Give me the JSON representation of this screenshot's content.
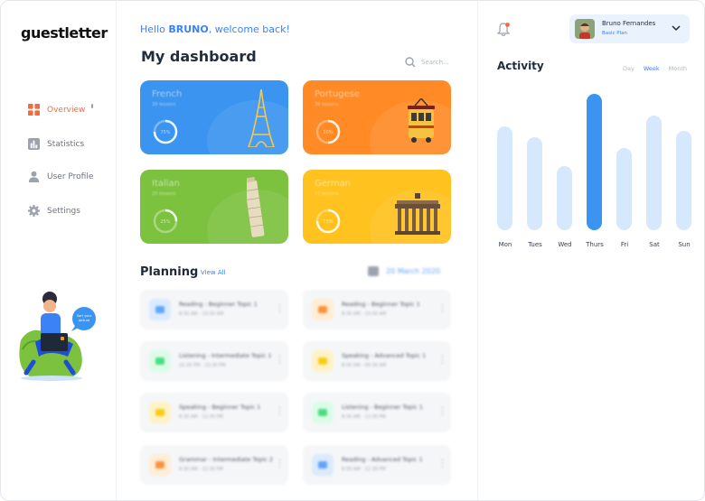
{
  "brand": {
    "logo": "guestletter"
  },
  "sidebar": {
    "items": [
      {
        "label": "Overview",
        "icon": "grid-icon",
        "active": true
      },
      {
        "label": "Statistics",
        "icon": "bar-chart-icon",
        "active": false
      },
      {
        "label": "User Profile",
        "icon": "user-icon",
        "active": false
      },
      {
        "label": "Settings",
        "icon": "gear-icon",
        "active": false
      }
    ],
    "promo_bubble": "Sort your picture"
  },
  "header": {
    "greeting_prefix": "Hello ",
    "user": "BRUNO",
    "greeting_suffix": ", welcome back!",
    "title": "My dashboard",
    "search_placeholder": "Search..."
  },
  "courses": [
    {
      "language": "French",
      "lessons": "39 lessons",
      "progress": "75%",
      "color": "#3b94f0",
      "icon": "eiffel-tower-icon"
    },
    {
      "language": "Portugese",
      "lessons": "39 lessons",
      "progress": "50%",
      "color": "#ff8a26",
      "icon": "tram-icon"
    },
    {
      "language": "Italian",
      "lessons": "20 lessons",
      "progress": "25%",
      "color": "#7cc23f",
      "icon": "leaning-tower-icon"
    },
    {
      "language": "German",
      "lessons": "15 lessons",
      "progress": "75%",
      "color": "#ffc21f",
      "icon": "brandenburg-gate-icon"
    }
  ],
  "planning": {
    "title": "Planning",
    "view_all": "View All",
    "date": "20 March 2020",
    "lessons": [
      {
        "title": "Reading - Beginner Topic 1",
        "time": "8:30 AM - 10:30 AM",
        "icon": "book-icon",
        "tint": "#dbeafe",
        "fg": "#60a5fa"
      },
      {
        "title": "Reading - Beginner Topic 1",
        "time": "8:30 AM - 10:30 AM",
        "icon": "pen-icon",
        "tint": "#ffedd5",
        "fg": "#fb923c"
      },
      {
        "title": "Listening - Intermediate Topic 1",
        "time": "22:30 PM - 23:30 PM",
        "icon": "headphones-icon",
        "tint": "#dcfce7",
        "fg": "#4ade80"
      },
      {
        "title": "Speaking - Advanced Topic 1",
        "time": "8:30 AM - 09:30 AM",
        "icon": "speaker-icon",
        "tint": "#fef3c7",
        "fg": "#facc15"
      },
      {
        "title": "Speaking - Beginner Topic 1",
        "time": "8:30 AM - 12:30 PM",
        "icon": "speaker-icon",
        "tint": "#fef3c7",
        "fg": "#facc15"
      },
      {
        "title": "Listening - Beginner Topic 1",
        "time": "8:30 AM - 12:30 PM",
        "icon": "headphones-icon",
        "tint": "#dcfce7",
        "fg": "#4ade80"
      },
      {
        "title": "Grammar - Intermediate Topic 2",
        "time": "8:30 AM - 12:30 PM",
        "icon": "pen-icon",
        "tint": "#ffedd5",
        "fg": "#fb923c"
      },
      {
        "title": "Reading - Advanced Topic 1",
        "time": "8:30 AM - 12:30 PM",
        "icon": "book-icon",
        "tint": "#dbeafe",
        "fg": "#60a5fa"
      }
    ]
  },
  "profile": {
    "name": "Bruno Fernandes",
    "plan": "Basic Plan"
  },
  "activity": {
    "title": "Activity",
    "tabs": [
      {
        "label": "Day",
        "active": false
      },
      {
        "label": "Week",
        "active": true
      },
      {
        "label": "Month",
        "active": false
      }
    ],
    "days": [
      "Mon",
      "Tues",
      "Wed",
      "Thurs",
      "Fri",
      "Sat",
      "Sun"
    ],
    "values": [
      0.76,
      0.68,
      0.47,
      1.0,
      0.6,
      0.84,
      0.73
    ],
    "highlight_index": 3
  },
  "colors": {
    "accent": "#3b82f6",
    "active_nav": "#f26b3a",
    "bar": "#d6e8fb",
    "bar_peak": "#3b94f0"
  }
}
